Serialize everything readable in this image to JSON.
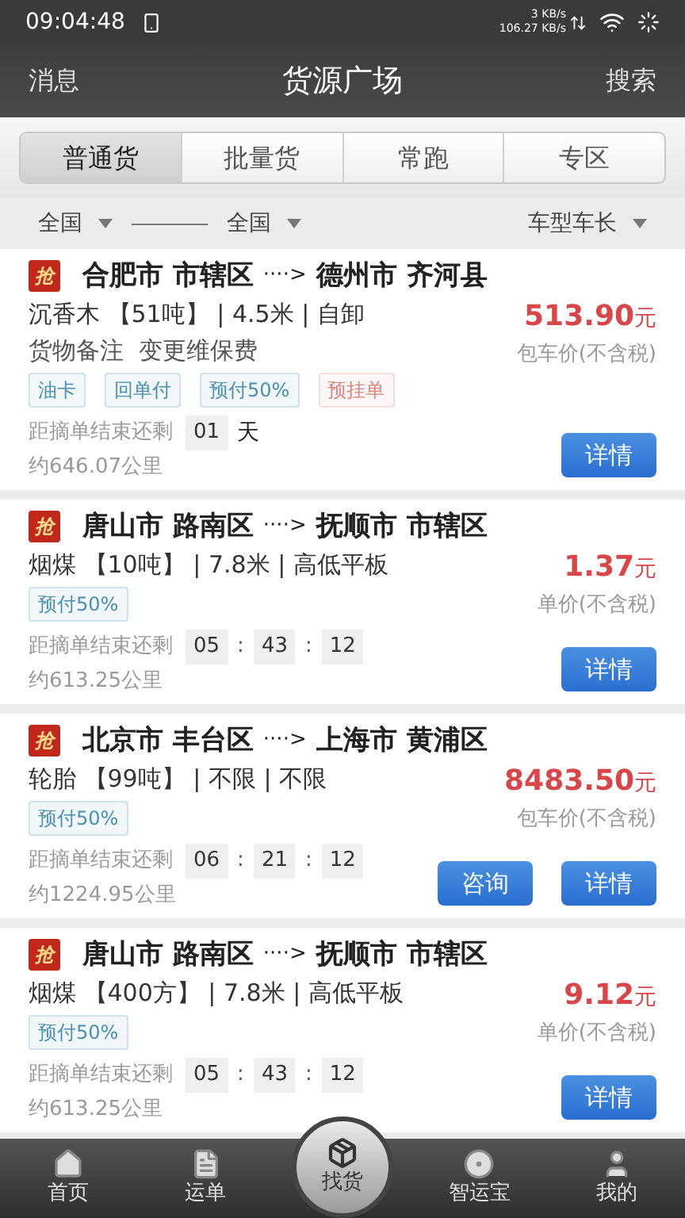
{
  "status_bar": {
    "time": "09:04:48",
    "speed_up": "3 KB/s",
    "speed_down": "106.27 KB/s"
  },
  "header": {
    "left": "消息",
    "title": "货源广场",
    "right": "搜索"
  },
  "tabs": [
    {
      "label": "普通货",
      "selected": true
    },
    {
      "label": "批量货",
      "selected": false
    },
    {
      "label": "常跑",
      "selected": false
    },
    {
      "label": "专区",
      "selected": false
    }
  ],
  "filters": {
    "from": "全国",
    "to": "全国",
    "vehicle": "车型车长"
  },
  "cards": [
    {
      "badge": "抢",
      "origin": "合肥市 市辖区",
      "arrow": "····>",
      "destination": "德州市 齐河县",
      "cargo": "沉香木 【51吨】 | 4.5米 | 自卸",
      "note": "货物备注  变更维保费",
      "price": "513.90",
      "unit": "元",
      "price_label": "包车价(不含税)",
      "tags": [
        {
          "text": "油卡",
          "color": "#4a8fb0"
        },
        {
          "text": "回单付",
          "color": "#4a8fb0"
        },
        {
          "text": "预付50%",
          "color": "#4a8fb0"
        },
        {
          "text": "预挂单",
          "color": "#d9837a"
        }
      ],
      "countdown_label": "距摘单结束还剩",
      "countdown": [
        {
          "kind": "box",
          "text": "01"
        },
        {
          "kind": "unit",
          "text": "天"
        }
      ],
      "distance": "约646.07公里",
      "buttons": [
        "详情"
      ]
    },
    {
      "badge": "抢",
      "origin": "唐山市 路南区",
      "arrow": "····>",
      "destination": "抚顺市 市辖区",
      "cargo": "烟煤 【10吨】 | 7.8米 | 高低平板",
      "price": "1.37",
      "unit": "元",
      "price_label": "单价(不含税)",
      "tags": [
        {
          "text": "预付50%",
          "color": "#4a8fb0"
        }
      ],
      "countdown_label": "距摘单结束还剩",
      "countdown": [
        {
          "kind": "box",
          "text": "05"
        },
        {
          "kind": "sep",
          "text": ":"
        },
        {
          "kind": "box",
          "text": "43"
        },
        {
          "kind": "sep",
          "text": ":"
        },
        {
          "kind": "box",
          "text": "12"
        }
      ],
      "distance": "约613.25公里",
      "buttons": [
        "详情"
      ]
    },
    {
      "badge": "抢",
      "origin": "北京市 丰台区",
      "arrow": "····>",
      "destination": "上海市 黄浦区",
      "cargo": "轮胎 【99吨】 | 不限 | 不限",
      "price": "8483.50",
      "unit": "元",
      "price_label": "包车价(不含税)",
      "tags": [
        {
          "text": "预付50%",
          "color": "#4a8fb0"
        }
      ],
      "countdown_label": "距摘单结束还剩",
      "countdown": [
        {
          "kind": "box",
          "text": "06"
        },
        {
          "kind": "sep",
          "text": ":"
        },
        {
          "kind": "box",
          "text": "21"
        },
        {
          "kind": "sep",
          "text": ":"
        },
        {
          "kind": "box",
          "text": "12"
        }
      ],
      "distance": "约1224.95公里",
      "buttons": [
        "咨询",
        "详情"
      ]
    },
    {
      "badge": "抢",
      "origin": "唐山市 路南区",
      "arrow": "····>",
      "destination": "抚顺市 市辖区",
      "cargo": "烟煤 【400方】 | 7.8米 | 高低平板",
      "price": "9.12",
      "unit": "元",
      "price_label": "单价(不含税)",
      "tags": [
        {
          "text": "预付50%",
          "color": "#4a8fb0"
        }
      ],
      "countdown_label": "距摘单结束还剩",
      "countdown": [
        {
          "kind": "box",
          "text": "05"
        },
        {
          "kind": "sep",
          "text": ":"
        },
        {
          "kind": "box",
          "text": "43"
        },
        {
          "kind": "sep",
          "text": ":"
        },
        {
          "kind": "box",
          "text": "12"
        }
      ],
      "distance": "约613.25公里",
      "buttons": [
        "详情"
      ]
    }
  ],
  "bottom_nav": [
    {
      "label": "首页",
      "selected": false
    },
    {
      "label": "运单",
      "selected": false
    },
    {
      "label": "找货",
      "selected": true
    },
    {
      "label": "智运宝",
      "selected": false
    },
    {
      "label": "我的",
      "selected": false
    }
  ]
}
